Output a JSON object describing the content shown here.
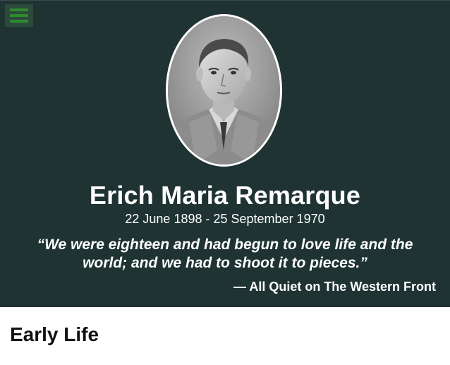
{
  "header": {
    "menu_icon": "hamburger-menu-icon",
    "name": "Erich Maria Remarque",
    "dates": "22 June 1898 - 25 September 1970",
    "quote": "“We were eighteen and had begun to love life and the world; and we had to shoot it to pieces.”",
    "attribution": "— All Quiet on The Western Front",
    "portrait_icon": "portrait-photo"
  },
  "main": {
    "section_title": "Early Life"
  },
  "colors": {
    "hero_background": "#1f3333",
    "menu_bar": "#2e8b2e",
    "text_light": "#ffffff",
    "text_dark": "#111111"
  }
}
